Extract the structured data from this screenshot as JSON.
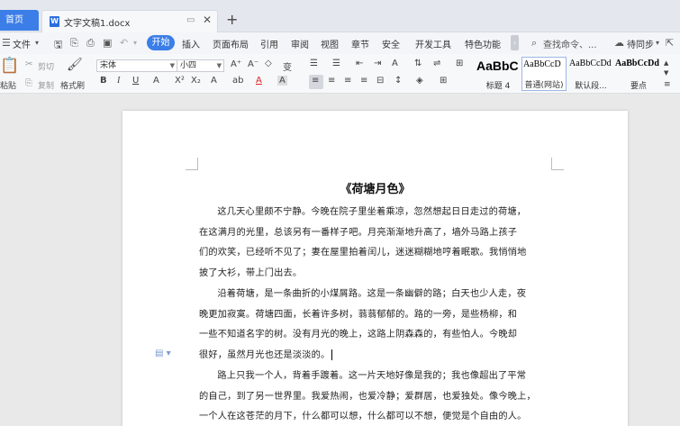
{
  "tabs": {
    "home": "首页",
    "doc_name": "文字文稿1.docx",
    "icon_letter": "W"
  },
  "menu": {
    "file": "文件",
    "items": [
      "开始",
      "插入",
      "页面布局",
      "引用",
      "审阅",
      "视图",
      "章节",
      "安全",
      "开发工具",
      "特色功能"
    ],
    "search": "查找命令、...",
    "sync": "待同步"
  },
  "ribbon": {
    "paste": "粘贴",
    "cut": "剪切",
    "copy": "复制",
    "format_painter": "格式刷",
    "font_name": "宋体",
    "font_size": "小四",
    "styles": [
      {
        "preview": "AaBbC",
        "label": "标题 4"
      },
      {
        "preview": "AaBbCcD",
        "label": "普通(网站)"
      },
      {
        "preview": "AaBbCcDd",
        "label": "默认段..."
      },
      {
        "preview": "AaBbCcDd",
        "label": "要点"
      }
    ]
  },
  "document": {
    "title": "《荷塘月色》",
    "p1": [
      "这几天心里颇不宁静。今晚在院子里坐着乘凉，忽然想起日日走过的荷塘，",
      "在这满月的光里，总该另有一番样子吧。月亮渐渐地升高了，墙外马路上孩子",
      "们的欢笑，已经听不见了；妻在屋里拍着闰儿，迷迷糊糊地哼着眠歌。我悄悄地",
      "披了大衫，带上门出去。"
    ],
    "p2": [
      "沿着荷塘，是一条曲折的小煤屑路。这是一条幽僻的路；白天也少人走，夜",
      "晚更加寂寞。荷塘四面，长着许多树，蓊蓊郁郁的。路的一旁，是些杨柳，和",
      "一些不知道名字的树。没有月光的晚上，这路上阴森森的，有些怕人。今晚却",
      "很好，虽然月光也还是淡淡的。"
    ],
    "p3": [
      "路上只我一个人，背着手踱着。这一片天地好像是我的；我也像超出了平常",
      "的自己，到了另一世界里。我爱热闹，也爱冷静；爱群居，也爱独处。像今晚上，",
      "一个人在这苍茫的月下，什么都可以想，什么都可以不想，便觉是个自由的人。"
    ]
  },
  "colors": {
    "accent": "#3b7ee8"
  }
}
